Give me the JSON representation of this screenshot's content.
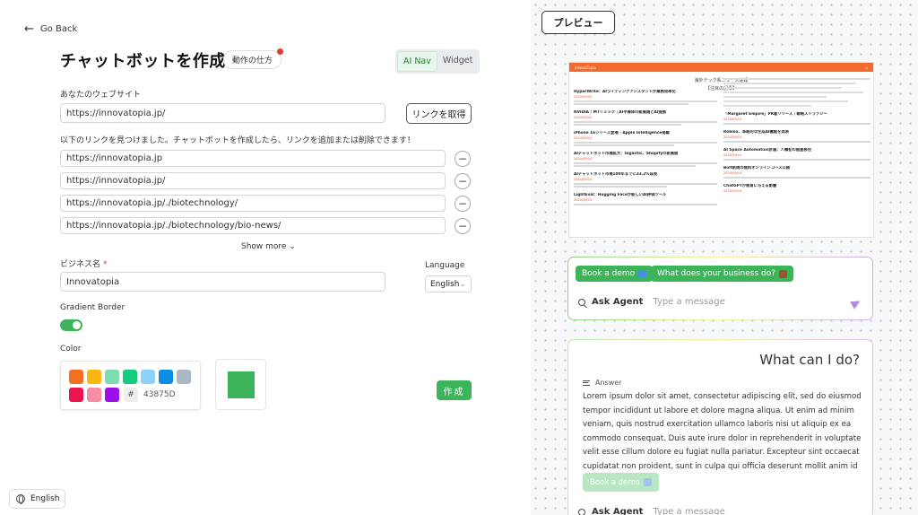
{
  "nav": {
    "back_label": "Go Back"
  },
  "header": {
    "title": "チャットボットを作成",
    "howto_label": "動作の仕方",
    "modes": [
      "AI Nav",
      "Widget"
    ],
    "active_mode": "AI Nav"
  },
  "website": {
    "label": "あなたのウェブサイト",
    "value": "https://innovatopia.jp/",
    "fetch_button": "リンクを取得",
    "found_message": "以下のリンクを見つけました。チャットボットを作成したら、リンクを追加または削除できます！",
    "links": [
      "https://innovatopia.jp",
      "https://innovatopia.jp/",
      "https://innovatopia.jp/./biotechnology/",
      "https://innovatopia.jp/./biotechnology/bio-news/"
    ],
    "show_more": "Show more"
  },
  "business": {
    "label": "ビジネス名",
    "required_mark": "*",
    "value": "Innovatopia"
  },
  "language": {
    "label": "Language",
    "value": "English"
  },
  "gradient_border": {
    "label": "Gradient Border",
    "enabled": true
  },
  "color": {
    "label": "Color",
    "swatches": [
      "#f36f21",
      "#fbb614",
      "#7fdcb0",
      "#13cc7c",
      "#8ed1fc",
      "#0b8fe3",
      "#abb8c3",
      "#eb144c",
      "#f78da7",
      "#9b10e8"
    ],
    "hash": "#",
    "hex_value": "43875D",
    "selected": "#3cb55a"
  },
  "create_button": "作成",
  "footer": {
    "language": "English"
  },
  "preview": {
    "label": "プレビュー",
    "site": {
      "brand": "innovaTopia",
      "heading": "海外テック系ニュース速報",
      "subheading": "【注目の記事】",
      "articles": [
        {
          "title": "HyperWrite：AIライティングアシスタントが業務効率化",
          "date": "2024/09/10"
        },
        {
          "title": "NVIDIA / MTリミック｜AI半導体の新展開とAI提携",
          "date": "2024/09/10"
        },
        {
          "title": "iPhone 16シリーズ登場 - Apple Intelligence搭載",
          "date": "2024/09/10"
        },
        {
          "title": "AIチャットボット市場拡大：Gigantic、Shopifyの新展開",
          "date": "2024/09/10"
        },
        {
          "title": "AIチャットボット市場100年までに33.2%成長",
          "date": "2024/09/10"
        },
        {
          "title": "LightEval：Hugging Faceが新しいAI評価ツール",
          "date": "2024/09/10"
        }
      ],
      "side_articles": [
        {
          "title": "「Margaret Empire」PR着リリース｜戦略ストラテジー",
          "date": "2024/09/10"
        },
        {
          "title": "Roblox、革新的な生成AI機能を発表",
          "date": "2024/09/10"
        },
        {
          "title": "AI Space Automation計画：人類初の惑星移住",
          "date": "2024/09/10"
        },
        {
          "title": "Bolt新規の無料オンラインコース公開",
          "date": "2024/09/10"
        },
        {
          "title": "ChatGPTが教育に与える影響",
          "date": "2024/09/10"
        }
      ]
    },
    "chat_suggestions": [
      {
        "label": "Book a demo",
        "icon": "calendar-icon",
        "icon_color": "#4a90e2"
      },
      {
        "label": "What does your business do?",
        "icon": "briefcase-icon",
        "icon_color": "#a0522d"
      }
    ],
    "ask_label": "Ask Agent",
    "placeholder": "Type a message",
    "answer_panel": {
      "title": "What can I do?",
      "answer_heading": "Answer",
      "answer_text": "Lorem ipsum dolor sit amet, consectetur adipiscing elit, sed do eiusmod tempor incididunt ut labore et dolore magna aliqua. Ut enim ad minim veniam, quis nostrud exercitation ullamco laboris nisi ut aliquip ex ea commodo consequat. Duis aute irure dolor in reprehenderit in voluptate velit esse cillum dolore eu fugiat nulla pariatur. Excepteur sint occaecat cupidatat non proident, sunt in culpa qui officia deserunt mollit anim id est laborum.",
      "suggestion": "Book a demo"
    }
  }
}
